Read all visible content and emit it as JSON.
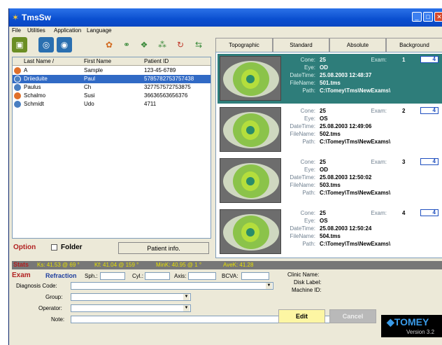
{
  "window": {
    "title": "TmsSw"
  },
  "menu": [
    "File",
    "Utilities",
    "Application",
    "Language"
  ],
  "toolbar": [
    {
      "name": "patients-icon",
      "glyph": "▣"
    },
    {
      "name": "eye-icon",
      "glyph": "◎"
    },
    {
      "name": "eyes-icon",
      "glyph": "◉"
    },
    {
      "name": "color-map-icon",
      "glyph": "✿"
    },
    {
      "name": "compare-icon",
      "glyph": "⚭"
    },
    {
      "name": "multi-map-icon",
      "glyph": "❖"
    },
    {
      "name": "quad-map-icon",
      "glyph": "⁂"
    },
    {
      "name": "rotate-map-icon",
      "glyph": "↻"
    },
    {
      "name": "difference-map-icon",
      "glyph": "⇆"
    }
  ],
  "tabs": [
    "Topographic",
    "Standard",
    "Absolute",
    "Background"
  ],
  "patients": {
    "columns": [
      "Last Name /",
      "First Name",
      "Patient ID"
    ],
    "rows": [
      {
        "last": "A",
        "first": "Sample",
        "id": "123-45-6789",
        "selected": false
      },
      {
        "last": "Driieduite",
        "first": "Paul",
        "id": "5785782753757438",
        "selected": true
      },
      {
        "last": "Paulus",
        "first": "Ch",
        "id": "327757572753875",
        "selected": false
      },
      {
        "last": "Schalmo",
        "first": "Susi",
        "id": "36636563656376",
        "selected": false
      },
      {
        "last": "Schmidt",
        "first": "Udo",
        "id": "4711",
        "selected": false
      }
    ]
  },
  "options": {
    "option_label": "Option",
    "folder_label": "Folder",
    "patient_info_label": "Patient info."
  },
  "exam_labels": {
    "cone": "Cone:",
    "eye": "Eye:",
    "datetime": "DateTime:",
    "filename": "FileName:",
    "path": "Path:",
    "exam": "Exam:"
  },
  "exams": [
    {
      "cone": "25",
      "eye": "OD",
      "datetime": "25.08.2003 12:48:37",
      "filename": "501.tms",
      "path": "C:\\Tomey\\Tms\\NewExams\\",
      "exam": "1",
      "box": "4",
      "selected": true
    },
    {
      "cone": "25",
      "eye": "OS",
      "datetime": "25.08.2003 12:49:06",
      "filename": "502.tms",
      "path": "C:\\Tomey\\Tms\\NewExams\\",
      "exam": "2",
      "box": "4",
      "selected": false
    },
    {
      "cone": "25",
      "eye": "OD",
      "datetime": "25.08.2003 12:50:02",
      "filename": "503.tms",
      "path": "C:\\Tomey\\Tms\\NewExams\\",
      "exam": "3",
      "box": "4",
      "selected": false
    },
    {
      "cone": "25",
      "eye": "OS",
      "datetime": "25.08.2003 12:50:24",
      "filename": "504.tms",
      "path": "C:\\Tomey\\Tms\\NewExams\\",
      "exam": "4",
      "box": "4",
      "selected": false
    }
  ],
  "stats": {
    "label": "Stats",
    "items": [
      "Ks: 41.53 @ 69 °",
      "Kf: 41.04 @ 159 °",
      "MinK: 40.95 @ 1 °",
      "AveK: 41.28"
    ]
  },
  "exam_panel": {
    "exam_label": "Exam",
    "refraction_label": "Refraction",
    "sph_label": "Sph.:",
    "cyl_label": "Cyl.:",
    "axis_label": "Axis:",
    "bcva_label": "BCVA:",
    "diagnosis_label": "Diagnosis Code:",
    "group_label": "Group:",
    "operator_label": "Operator:",
    "note_label": "Note:",
    "clinic_label": "Clinic Name:",
    "disk_label": "Disk Label:",
    "machine_label": "Machine ID:",
    "edit_label": "Edit",
    "cancel_label": "Cancel"
  },
  "logo": {
    "brand": "◆TOMEY",
    "version": "Version 3.2"
  },
  "colors": {
    "selected_row": "#316ac5",
    "selected_exam": "#2e7d7a",
    "option_red": "#b22222",
    "titlebar": "#0a4ecf"
  }
}
